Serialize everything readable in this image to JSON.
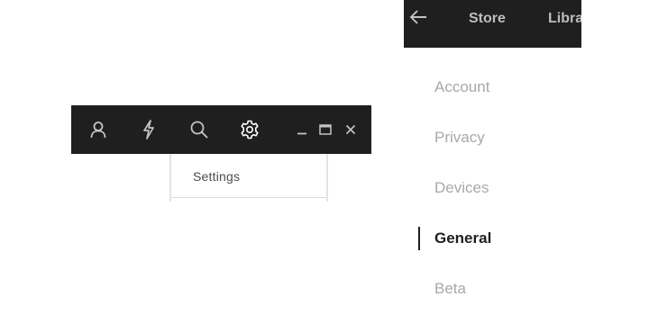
{
  "toolbar": {
    "icons": [
      "profile-icon",
      "lightning-icon",
      "search-icon",
      "gear-icon",
      "minimize-icon",
      "maximize-icon",
      "close-icon"
    ],
    "icon_color": "#c4c4c4",
    "background": "#1f1f1f"
  },
  "settings_dropdown": {
    "item_label": "Settings"
  },
  "top_nav": {
    "back_icon": "arrow-left-icon",
    "links": [
      "Store",
      "Library"
    ]
  },
  "settings_menu": {
    "items": [
      "Account",
      "Privacy",
      "Devices",
      "General",
      "Beta"
    ],
    "active_item": "General",
    "active_color": "#1f1f1f",
    "inactive_color": "#a8a8a8"
  }
}
